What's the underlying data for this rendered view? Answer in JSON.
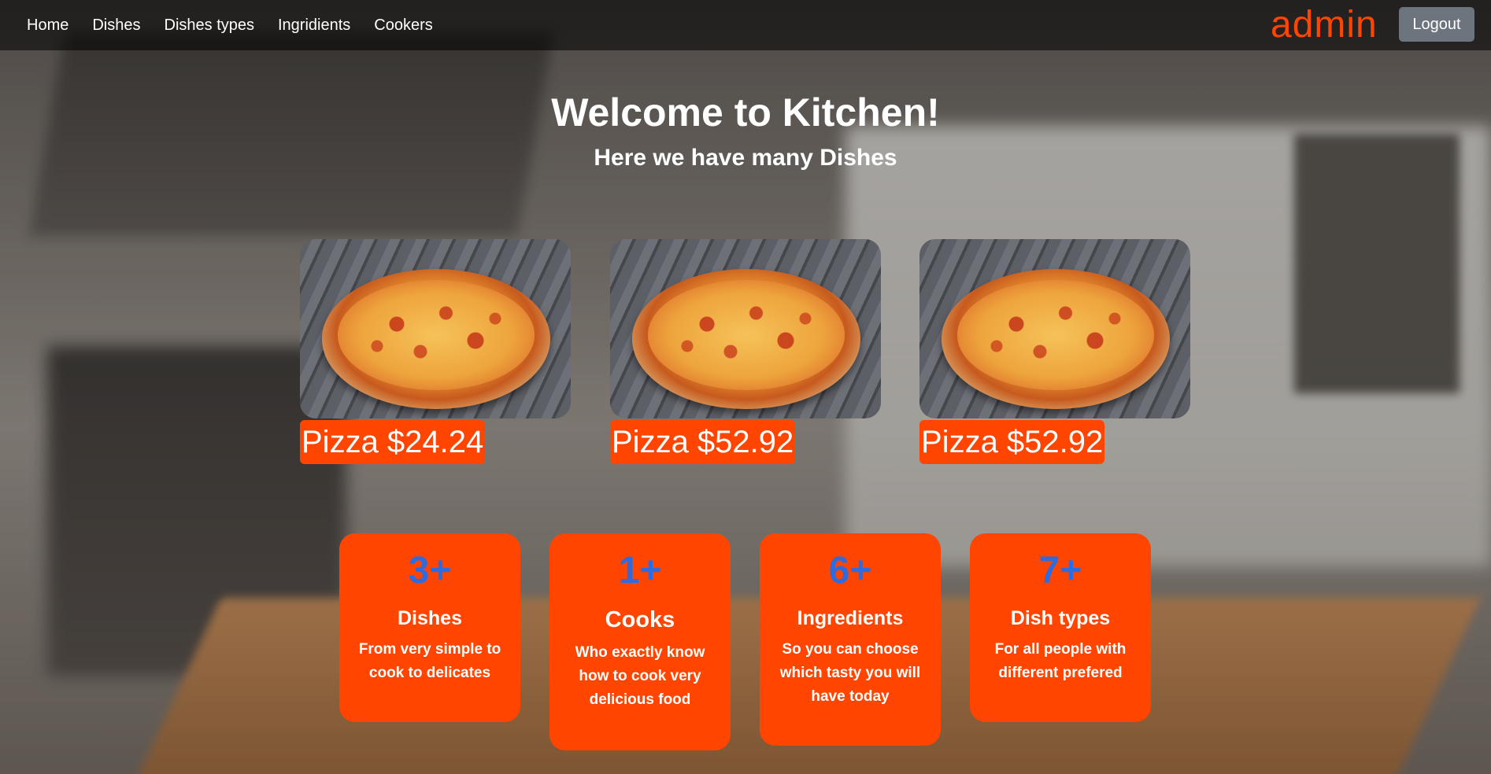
{
  "nav": {
    "links": [
      "Home",
      "Dishes",
      "Dishes types",
      "Ingridients",
      "Cookers"
    ],
    "user": "admin",
    "logout_label": "Logout"
  },
  "hero": {
    "title": "Welcome to Kitchen!",
    "subtitle": "Here we have many Dishes"
  },
  "dishes": [
    {
      "label": "Pizza $24.24"
    },
    {
      "label": "Pizza $52.92"
    },
    {
      "label": "Pizza $52.92"
    }
  ],
  "stats": [
    {
      "number": "3+",
      "title": "Dishes",
      "description": "From very simple to cook to delicates"
    },
    {
      "number": "1+",
      "title": "Cooks",
      "description": "Who exactly know how to cook very delicious food"
    },
    {
      "number": "6+",
      "title": "Ingredients",
      "description": "So you can choose which tasty you will have today"
    },
    {
      "number": "7+",
      "title": "Dish types",
      "description": "For all people with different prefered"
    }
  ],
  "colors": {
    "accent": "#ff4500",
    "stat_number": "#2f6bdc",
    "logout_button": "#6c757d"
  }
}
